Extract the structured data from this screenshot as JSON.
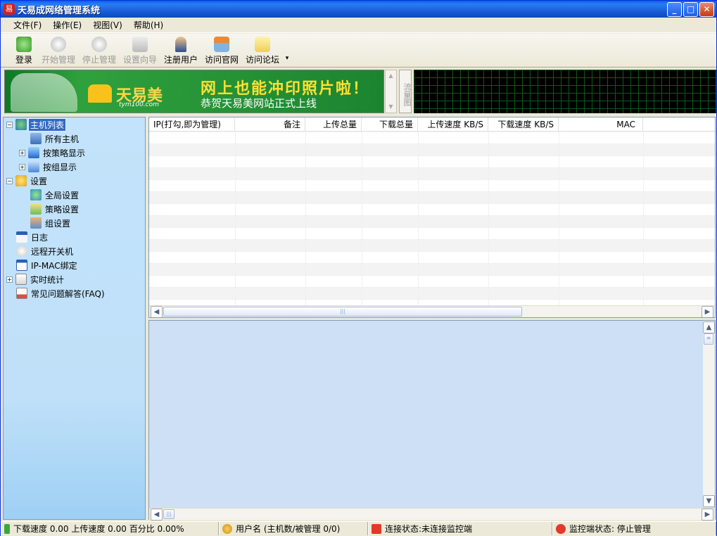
{
  "window": {
    "title": "天易成网络管理系统"
  },
  "menu": [
    "文件(F)",
    "操作(E)",
    "视图(V)",
    "帮助(H)"
  ],
  "toolbar": {
    "login": "登录",
    "start": "开始管理",
    "stop": "停止管理",
    "wizard": "设置向导",
    "register": "注册用户",
    "site": "访问官网",
    "forum": "访问论坛"
  },
  "banner": {
    "brand": "天易美",
    "url": "tym100.com",
    "headline": "网上也能冲印照片啦！",
    "sub": "恭贺天易美网站正式上线"
  },
  "flow_label": "流量图",
  "tree": {
    "host_list": "主机列表",
    "all_hosts": "所有主机",
    "by_policy": "按策略显示",
    "by_group": "按组显示",
    "settings": "设置",
    "global": "全局设置",
    "policy": "策略设置",
    "group": "组设置",
    "log": "日志",
    "remote": "远程开关机",
    "ipmac": "IP-MAC绑定",
    "stats": "实时统计",
    "faq": "常见问题解答(FAQ)"
  },
  "grid": {
    "columns": [
      "IP(打勾,即为管理)",
      "备注",
      "上传总量",
      "下载总量",
      "上传速度 KB/S",
      "下载速度 KB/S",
      "MAC"
    ]
  },
  "status": {
    "speed": "下载速度 0.00 上传速度 0.00 百分比 0.00%",
    "user": "用户名  (主机数/被管理 0/0)",
    "conn": "连接状态:未连接监控端",
    "monitor": "监控端状态: 停止管理"
  }
}
